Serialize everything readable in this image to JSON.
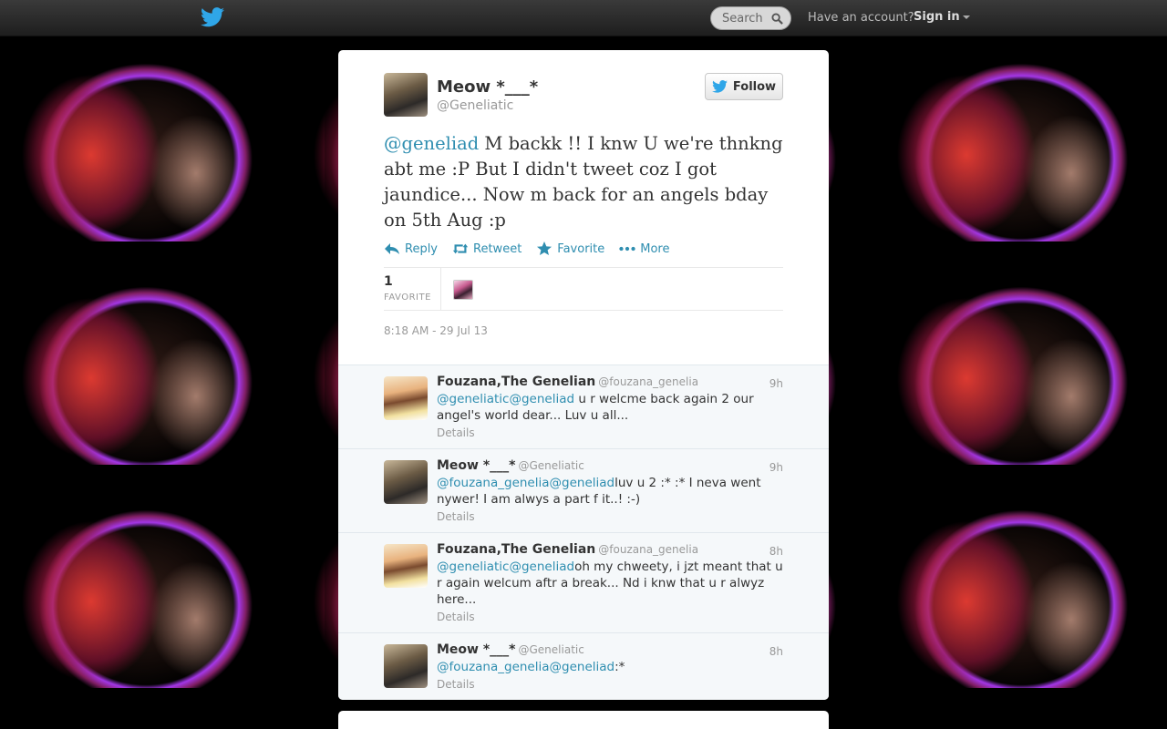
{
  "topbar": {
    "search_placeholder": "Search",
    "account_prompt": "Have an account?",
    "signin_label": "Sign in"
  },
  "tweet": {
    "fullname": "Meow *___*",
    "screen_name": "@Geneliatic",
    "follow_label": "Follow",
    "mention": "@geneliad",
    "text": " M backk !! I knw U we're thnkng abt me :P But I didn't tweet coz I got jaundice... Now m back for an angels bday on 5th Aug :p",
    "actions": {
      "reply": "Reply",
      "retweet": "Retweet",
      "favorite": "Favorite",
      "more": "More"
    },
    "favorite_count": "1",
    "favorite_label": "FAVORITE",
    "timestamp": "8:18 AM - 29 Jul 13"
  },
  "replies": [
    {
      "name": "Fouzana,The Genelian",
      "screen": "@fouzana_genelia",
      "time": "9h",
      "mentions": "@geneliatic@geneliad",
      "text": " u r welcme back again 2 our angel's world dear... Luv u all...",
      "details": "Details"
    },
    {
      "name": "Meow *___*",
      "screen": "@Geneliatic",
      "time": "9h",
      "mentions": "@fouzana_genelia@geneliad",
      "text": "luv u 2 :* :* I neva went nywer! I am alwys a part f it..! :-)",
      "details": "Details"
    },
    {
      "name": "Fouzana,The Genelian",
      "screen": "@fouzana_genelia",
      "time": "8h",
      "mentions": "@geneliatic@geneliad",
      "text": "oh my chweety,  i jzt meant that u r again welcum aftr a break...   Nd i knw that u r alwyz here...",
      "details": "Details"
    },
    {
      "name": "Meow *___*",
      "screen": "@Geneliatic",
      "time": "8h",
      "mentions": "@fouzana_genelia@geneliad",
      "text": ":*",
      "details": "Details"
    }
  ],
  "colors": {
    "link": "#2f8eb0",
    "topbar": "#2a2a2a",
    "twitter_blue": "#2fa6e8"
  }
}
